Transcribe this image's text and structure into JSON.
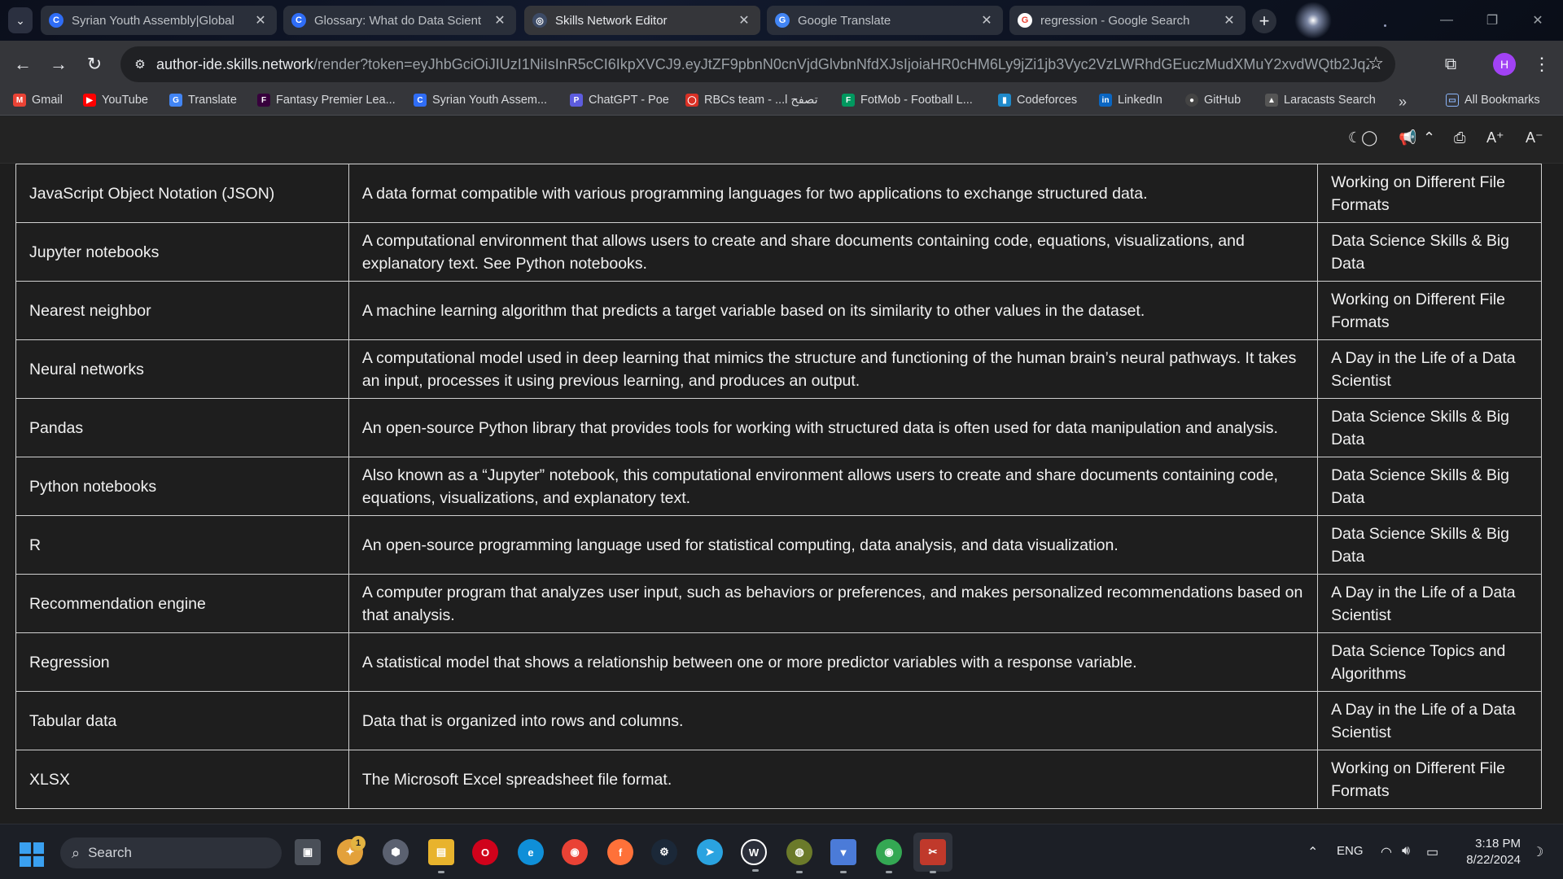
{
  "tabs": [
    {
      "title": "Syrian Youth Assembly|Global",
      "favicon": "C",
      "favicon_color": "#2f6df6",
      "active": false
    },
    {
      "title": "Glossary: What do Data Scient",
      "favicon": "C",
      "favicon_color": "#2f6df6",
      "active": false
    },
    {
      "title": "Skills Network Editor",
      "favicon": "◎",
      "favicon_color": "#3d4b66",
      "active": true
    },
    {
      "title": "Google Translate",
      "favicon": "G",
      "favicon_color": "#4285f4",
      "active": false
    },
    {
      "title": "regression - Google Search",
      "favicon": "G",
      "favicon_color": "#ea4335",
      "active": false
    }
  ],
  "address_bar": {
    "host": "author-ide.skills.network",
    "path": "/render?token=eyJhbGciOiJIUzI1NiIsInR5cCI6IkpXVCJ9.eyJtZF9pbnN0cnVjdGlvbnNfdXJsIjoiaHR0cHM6Ly9jZi1jb3Vyc2VzLWRhdGEuczMudXMuY2xvdWQtb2JqZWN0LXN..."
  },
  "profile_initial": "H",
  "bookmarks": [
    {
      "label": "Gmail",
      "icon": "gmail-icon",
      "glyph": "M",
      "color": "#ea4335"
    },
    {
      "label": "YouTube",
      "icon": "youtube-icon",
      "glyph": "▶",
      "color": "#ff0000"
    },
    {
      "label": "Translate",
      "icon": "translate-icon",
      "glyph": "G",
      "color": "#4285f4"
    },
    {
      "label": "Fantasy Premier Lea...",
      "icon": "fantasy-premier-league-icon",
      "glyph": "F",
      "color": "#37003c"
    },
    {
      "label": "Syrian Youth Assem...",
      "icon": "syrian-youth-icon",
      "glyph": "C",
      "color": "#2f6df6"
    },
    {
      "label": "ChatGPT - Poe",
      "icon": "poe-icon",
      "glyph": "P",
      "color": "#5d5cde"
    },
    {
      "label": "RBCs team - ...l تصفح",
      "icon": "rbcs-icon",
      "glyph": "◯",
      "color": "#d93025"
    },
    {
      "label": "FotMob - Football L...",
      "icon": "fotmob-icon",
      "glyph": "F",
      "color": "#00985f"
    },
    {
      "label": "Codeforces",
      "icon": "codeforces-icon",
      "glyph": "▮",
      "color": "#1f8acb"
    },
    {
      "label": "LinkedIn",
      "icon": "linkedin-icon",
      "glyph": "in",
      "color": "#0a66c2"
    },
    {
      "label": "GitHub",
      "icon": "github-icon",
      "glyph": "●",
      "color": "#444"
    },
    {
      "label": "Laracasts Search",
      "icon": "laracasts-icon",
      "glyph": "▲",
      "color": "#555"
    }
  ],
  "all_bookmarks_label": "All Bookmarks",
  "glossary": [
    {
      "term": "JavaScript Object Notation (JSON)",
      "definition": "A data format compatible with various programming languages for two applications to exchange structured data.",
      "module": "Working on Different File Formats"
    },
    {
      "term": "Jupyter notebooks",
      "definition": "A computational environment that allows users to create and share documents containing code, equations, visualizations, and explanatory text. See Python notebooks.",
      "module": "Data Science Skills & Big Data"
    },
    {
      "term": "Nearest neighbor",
      "definition": "A machine learning algorithm that predicts a target variable based on its similarity to other values in the dataset.",
      "module": "Working on Different File Formats"
    },
    {
      "term": "Neural networks",
      "definition": "A computational model used in deep learning that mimics the structure and functioning of the human brain’s neural pathways. It takes an input, processes it using previous learning, and produces an output.",
      "module": "A Day in the Life of a Data Scientist"
    },
    {
      "term": "Pandas",
      "definition": "An open-source Python library that provides tools for working with structured data is often used for data manipulation and analysis.",
      "module": "Data Science Skills & Big Data"
    },
    {
      "term": "Python notebooks",
      "definition": "Also known as a “Jupyter” notebook, this computational environment allows users to create and share documents containing code, equations, visualizations, and explanatory text.",
      "module": "Data Science Skills & Big Data"
    },
    {
      "term": "R",
      "definition": "An open-source programming language used for statistical computing, data analysis, and data visualization.",
      "module": "Data Science Skills & Big Data"
    },
    {
      "term": "Recommendation engine",
      "definition": "A computer program that analyzes user input, such as behaviors or preferences, and makes personalized recommendations based on that analysis.",
      "module": "A Day in the Life of a Data Scientist"
    },
    {
      "term": "Regression",
      "definition": "A statistical model that shows a relationship between one or more predictor variables with a response variable.",
      "module": "Data Science Topics and Algorithms"
    },
    {
      "term": "Tabular data",
      "definition": "Data that is organized into rows and columns.",
      "module": "A Day in the Life of a Data Scientist"
    },
    {
      "term": "XLSX",
      "definition": "The Microsoft Excel spreadsheet file format.",
      "module": "Working on Different File Formats"
    }
  ],
  "taskbar": {
    "search_placeholder": "Search",
    "notification_count": "1",
    "language": "ENG",
    "time": "3:18 PM",
    "date": "8/22/2024"
  }
}
